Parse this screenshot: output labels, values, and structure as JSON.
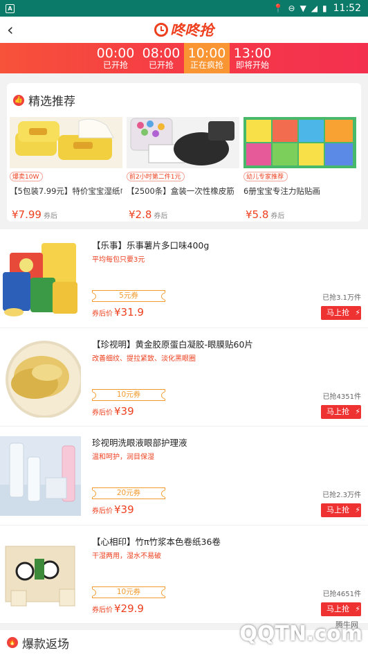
{
  "status_bar": {
    "time": "11:52"
  },
  "nav": {
    "back": "‹",
    "logo_text": "咚咚抢"
  },
  "time_slots": [
    {
      "time": "00:00",
      "status": "已开抢"
    },
    {
      "time": "08:00",
      "status": "已开抢"
    },
    {
      "time": "10:00",
      "status": "正在疯抢"
    },
    {
      "time": "13:00",
      "status": "即将开始"
    }
  ],
  "featured": {
    "title": "精选推荐",
    "items": [
      {
        "tag": "爆卖10W",
        "name": "【5包装7.99元】特价宝宝湿纸巾",
        "price": "¥7.99",
        "suffix": "券后"
      },
      {
        "tag": "前2小时第二件1元",
        "name": "【2500条】盒装一次性橡皮筋",
        "price": "¥2.8",
        "suffix": "券后"
      },
      {
        "tag": "幼儿专家推荐",
        "name": "6册宝宝专注力贴贴画",
        "price": "¥5.8",
        "suffix": "券后"
      }
    ]
  },
  "products": [
    {
      "name": "【乐事】乐事薯片多口味400g",
      "desc": "平均每包只要3元",
      "coupon": "5元券",
      "price_label": "券后价",
      "price": "¥31.9",
      "sold": "已抢3.1万件",
      "buy": "马上抢"
    },
    {
      "name": "【珍视明】黄金胶原蛋白凝胶-眼膜贴60片",
      "desc": "改善细纹、提拉紧致、淡化黑眼圈",
      "coupon": "10元券",
      "price_label": "券后价",
      "price": "¥39",
      "sold": "已抢4351件",
      "buy": "马上抢"
    },
    {
      "name": "珍视明洗眼液眼部护理液",
      "desc": "温和呵护，润目保湿",
      "coupon": "20元券",
      "price_label": "券后价",
      "price": "¥39",
      "sold": "已抢2.3万件",
      "buy": "马上抢"
    },
    {
      "name": "【心相印】竹π竹浆本色卷纸36卷",
      "desc": "干湿两用，湿水不易破",
      "coupon": "10元券",
      "price_label": "券后价",
      "price": "¥29.9",
      "sold": "已抢4651件",
      "buy": "马上抢"
    }
  ],
  "section2": {
    "title": "爆款返场"
  },
  "watermark": {
    "text": "QQTN.com",
    "small": "腾牛网"
  }
}
